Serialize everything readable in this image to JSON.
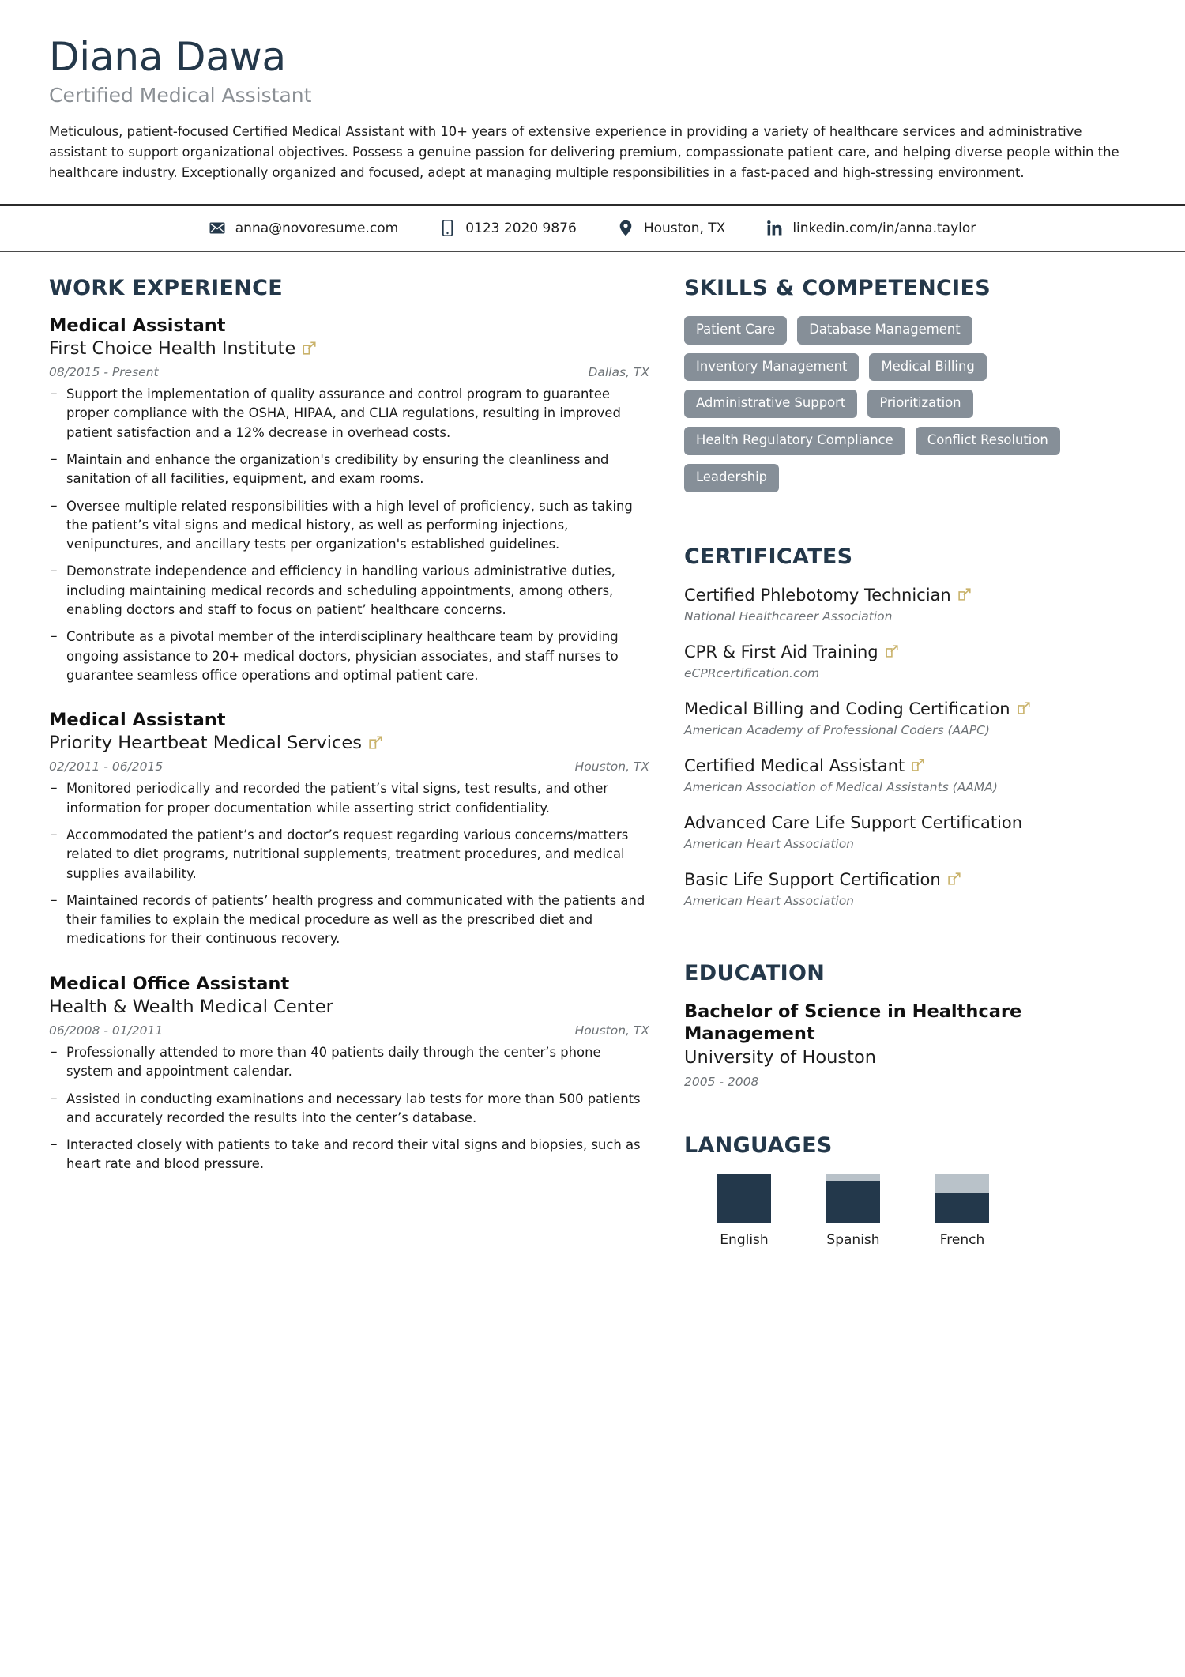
{
  "header": {
    "name": "Diana Dawa",
    "job_title": "Certified Medical Assistant",
    "summary": "Meticulous, patient-focused Certified Medical Assistant with 10+ years of extensive experience in providing a variety of healthcare services and administrative assistant to support organizational objectives. Possess a genuine passion for delivering premium, compassionate patient care, and helping diverse people within the healthcare industry. Exceptionally organized and focused, adept at managing multiple responsibilities in a fast-paced and high-stressing environment."
  },
  "contact": {
    "items": [
      {
        "icon": "envelope-icon",
        "value": "anna@novoresume.com"
      },
      {
        "icon": "phone-icon",
        "value": "0123 2020 9876"
      },
      {
        "icon": "location-pin-icon",
        "value": "Houston, TX"
      },
      {
        "icon": "linkedin-icon",
        "value": "linkedin.com/in/anna.taylor"
      }
    ]
  },
  "work_experience": {
    "heading": "WORK EXPERIENCE",
    "entries": [
      {
        "role": "Medical Assistant",
        "company": "First Choice Health Institute",
        "has_link": true,
        "dates": "08/2015 - Present",
        "location": "Dallas, TX",
        "bullets": [
          "Support the implementation of quality assurance and control program to guarantee proper compliance with the OSHA, HIPAA, and CLIA regulations, resulting in improved patient satisfaction and a 12% decrease in overhead costs.",
          "Maintain and enhance the organization's credibility by ensuring the cleanliness and sanitation of all facilities, equipment, and exam rooms.",
          "Oversee multiple related responsibilities with a high level of proficiency, such as taking the patient’s vital signs and medical history, as well as performing injections, venipunctures, and ancillary tests per organization's established guidelines.",
          "Demonstrate independence and efficiency in handling various administrative duties, including maintaining medical records and scheduling appointments, among others, enabling doctors and staff to focus on patient’ healthcare concerns.",
          "Contribute as a pivotal member of the interdisciplinary healthcare team by providing ongoing assistance to 20+ medical doctors, physician associates, and staff nurses to guarantee seamless office operations and optimal patient care."
        ]
      },
      {
        "role": "Medical Assistant",
        "company": "Priority Heartbeat Medical Services",
        "has_link": true,
        "dates": "02/2011 - 06/2015",
        "location": "Houston, TX",
        "bullets": [
          "Monitored periodically and recorded the patient’s vital signs, test results, and other information for proper documentation while asserting strict confidentiality.",
          "Accommodated the patient’s and doctor’s request regarding various concerns/matters related to diet programs, nutritional supplements, treatment procedures, and medical supplies availability.",
          "Maintained records of patients’ health progress and communicated with the patients and their families to explain the medical procedure as well as the prescribed diet and medications for their continuous recovery."
        ]
      },
      {
        "role": "Medical Office Assistant",
        "company": "Health & Wealth Medical Center",
        "has_link": false,
        "dates": "06/2008 - 01/2011",
        "location": "Houston, TX",
        "bullets": [
          "Professionally attended to more than 40 patients daily through the center’s phone system and appointment calendar.",
          "Assisted in conducting examinations and necessary lab tests for more than 500 patients and accurately recorded the results into the center’s database.",
          "Interacted closely with patients to take and record their vital signs and biopsies, such as heart rate and blood pressure."
        ]
      }
    ]
  },
  "skills": {
    "heading": "SKILLS & COMPETENCIES",
    "items": [
      "Patient Care",
      "Database Management",
      "Inventory Management",
      "Medical Billing",
      "Administrative Support",
      "Prioritization",
      "Health Regulatory Compliance",
      "Conflict Resolution",
      "Leadership"
    ]
  },
  "certificates": {
    "heading": "CERTIFICATES",
    "items": [
      {
        "name": "Certified Phlebotomy Technician",
        "issuer": "National Healthcareer Association",
        "has_link": true
      },
      {
        "name": "CPR & First Aid Training",
        "issuer": "eCPRcertification.com",
        "has_link": true
      },
      {
        "name": "Medical Billing and Coding Certification",
        "issuer": "American Academy of Professional Coders (AAPC)",
        "has_link": true
      },
      {
        "name": "Certified Medical Assistant",
        "issuer": "American Association of Medical Assistants (AAMA)",
        "has_link": true
      },
      {
        "name": "Advanced Care Life Support Certification",
        "issuer": "American Heart Association",
        "has_link": false
      },
      {
        "name": "Basic Life Support Certification",
        "issuer": "American Heart Association",
        "has_link": true
      }
    ]
  },
  "education": {
    "heading": "EDUCATION",
    "degree": "Bachelor of Science in Healthcare Management",
    "school": "University of Houston",
    "dates": "2005 - 2008"
  },
  "languages": {
    "heading": "LANGUAGES",
    "items": [
      {
        "label": "English",
        "level": 100
      },
      {
        "label": "Spanish",
        "level": 85
      },
      {
        "label": "French",
        "level": 62
      }
    ]
  },
  "colors": {
    "heading_navy": "#24384a",
    "skill_pill": "#868f98",
    "link_icon_gold": "#c9b26a",
    "muted_text": "#6d7276",
    "meter_track": "#b9c2c9",
    "meter_fill": "#23384b"
  }
}
